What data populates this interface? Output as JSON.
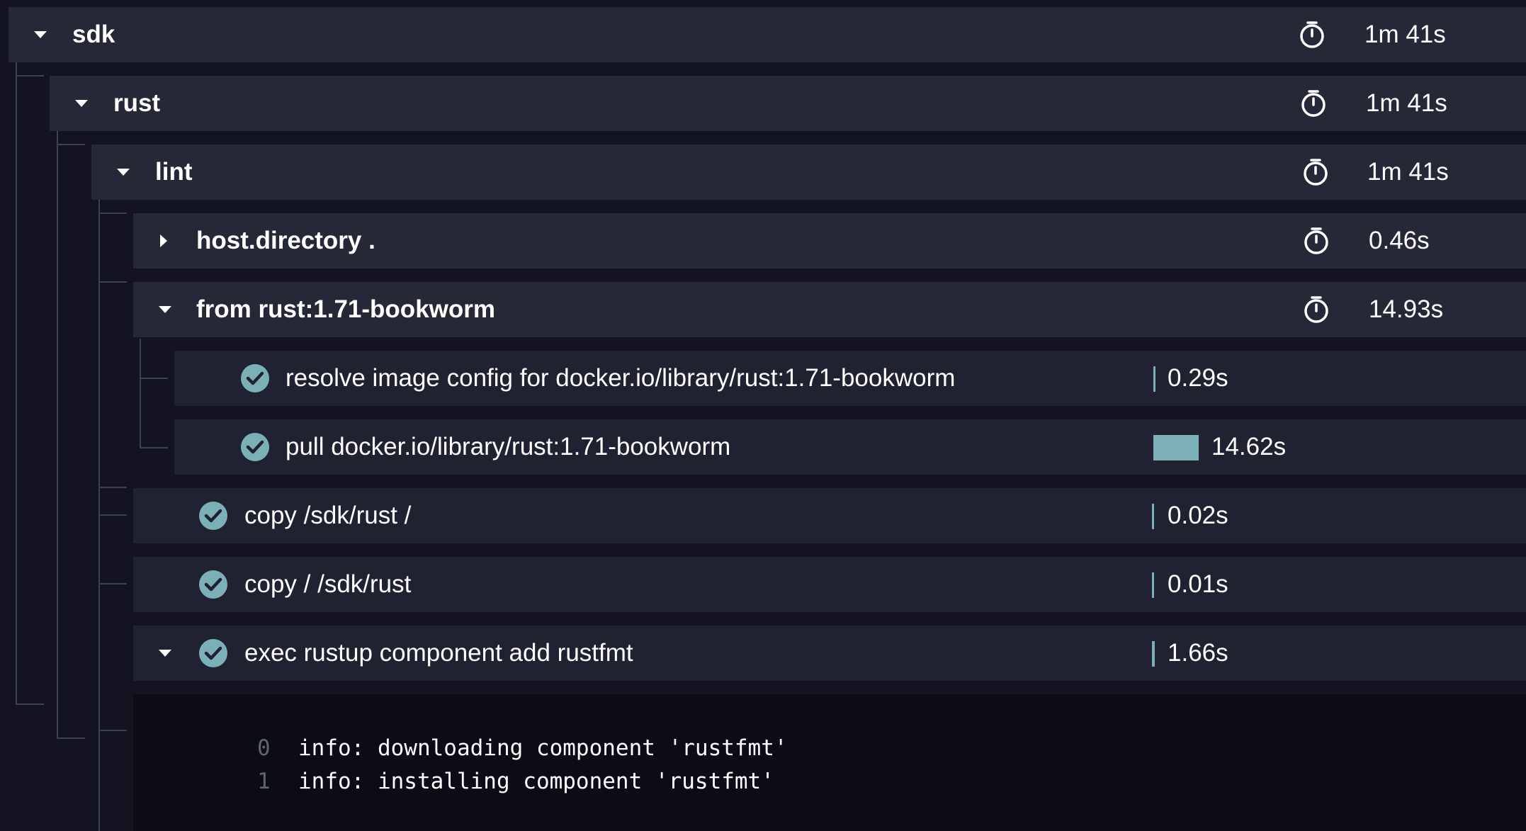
{
  "rows": [
    {
      "name": "sdk",
      "duration": "1m 41s"
    },
    {
      "name": "rust",
      "duration": "1m 41s"
    },
    {
      "name": "lint",
      "duration": "1m 41s"
    },
    {
      "name": "host.directory .",
      "duration": "0.46s"
    },
    {
      "name": "from rust:1.71-bookworm",
      "duration": "14.93s"
    },
    {
      "name": "resolve image config for docker.io/library/rust:1.71-bookworm",
      "duration": "0.29s",
      "status": "success"
    },
    {
      "name": "pull docker.io/library/rust:1.71-bookworm",
      "duration": "14.62s",
      "status": "success"
    },
    {
      "name": "copy /sdk/rust /",
      "duration": "0.02s",
      "status": "success"
    },
    {
      "name": "copy / /sdk/rust",
      "duration": "0.01s",
      "status": "success"
    },
    {
      "name": "exec rustup component add rustfmt",
      "duration": "1.66s",
      "status": "success"
    }
  ],
  "log": [
    {
      "num": "0",
      "text": "info: downloading component 'rustfmt'"
    },
    {
      "num": "1",
      "text": "info: installing component 'rustfmt'"
    }
  ],
  "colors": {
    "accent": "#7bb1b6",
    "success": "#7bb1b6",
    "background": "#13141f"
  },
  "icons": {
    "expand": "chevron-down-icon",
    "collapse": "chevron-right-icon",
    "timer": "stopwatch-icon",
    "done": "check-circle-icon"
  }
}
